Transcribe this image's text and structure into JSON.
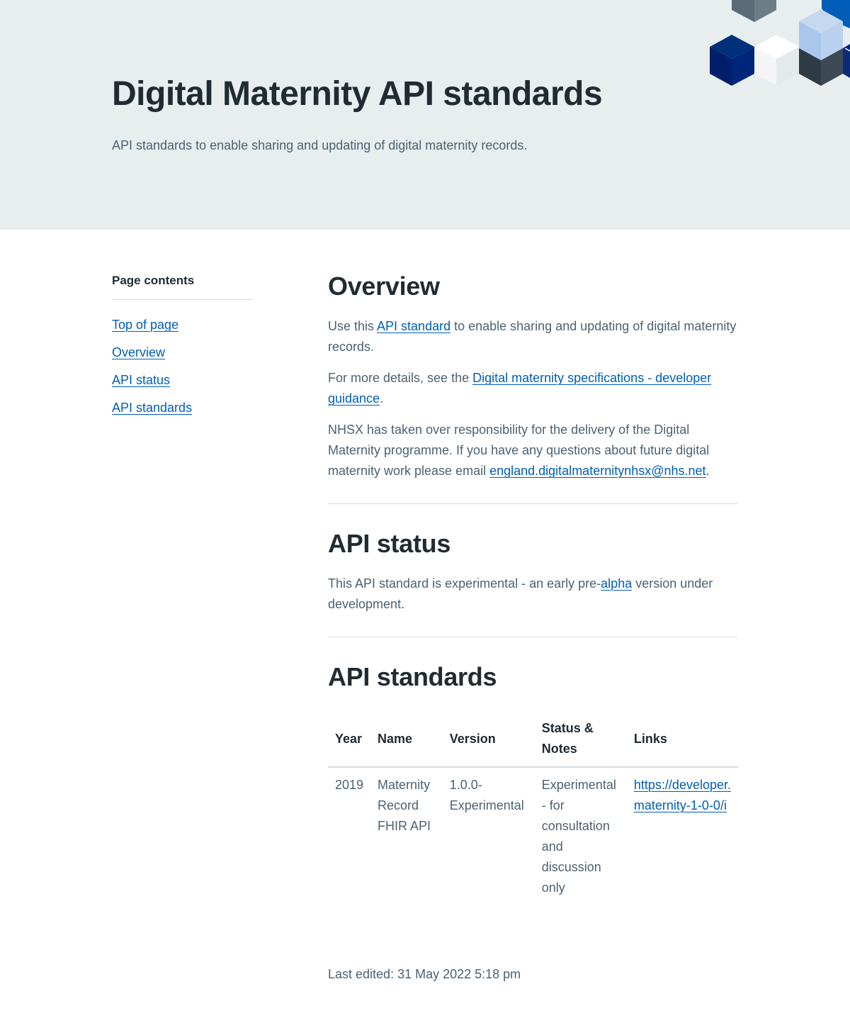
{
  "hero": {
    "title": "Digital Maternity API standards",
    "subtitle": "API standards to enable sharing and updating of digital maternity records."
  },
  "sidebar": {
    "heading": "Page contents",
    "items": [
      {
        "label": "Top of page"
      },
      {
        "label": "Overview"
      },
      {
        "label": "API status"
      },
      {
        "label": "API standards"
      }
    ]
  },
  "overview": {
    "heading": "Overview",
    "p1_before": "Use this ",
    "p1_link": "API standard",
    "p1_after": " to enable sharing and updating of digital maternity records.",
    "p2_before": "For more details, see the ",
    "p2_link": "Digital maternity specifications - developer guidance",
    "p2_after": ".",
    "p3_text": "NHSX has taken over responsibility for the delivery of the Digital Maternity programme. If you have any questions about future digital maternity work please email ",
    "p3_link": "england.digitalmaternitynhsx@nhs.net",
    "p3_after": "."
  },
  "status": {
    "heading": "API status",
    "text_before": "This API standard is experimental - an early pre-",
    "link": "alpha",
    "text_after": " version under development."
  },
  "standards": {
    "heading": "API standards",
    "columns": [
      "Year",
      "Name",
      "Version",
      "Status & Notes",
      "Links"
    ],
    "rows": [
      {
        "year": "2019",
        "name": "Maternity Record FHIR API",
        "version": "1.0.0-Experimental",
        "status": "Experimental - for consultation and discussion only",
        "link_line1": "https://developer.",
        "link_line2": "maternity-1-0-0/i"
      }
    ]
  },
  "footer": {
    "last_edited": "Last edited: 31 May 2022 5:18 pm"
  },
  "colors": {
    "hero_bg": "#e8edee",
    "link": "#005eb8",
    "text": "#212b32",
    "secondary_text": "#4c6272",
    "rule": "#d8dde0"
  }
}
